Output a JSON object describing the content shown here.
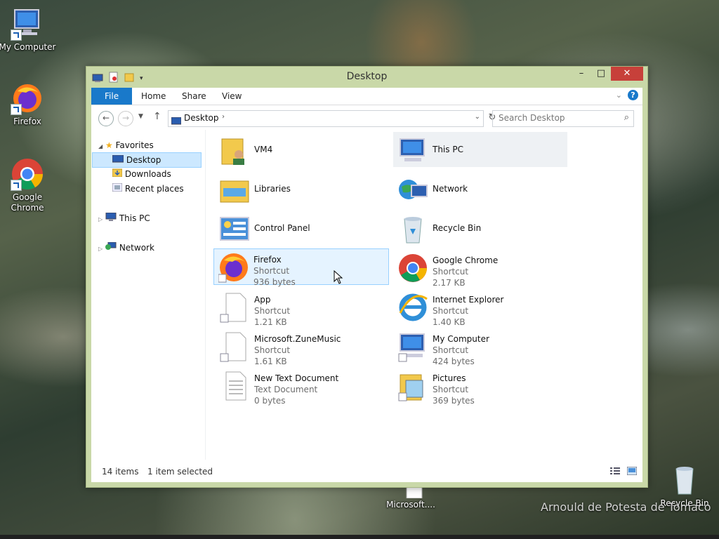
{
  "desktop": {
    "icons": [
      {
        "label": "My Computer"
      },
      {
        "label": "Firefox"
      },
      {
        "label": "Google Chrome"
      },
      {
        "label": "Recycle Bin"
      },
      {
        "label": "Microsoft...."
      }
    ],
    "watermark": "Arnould de Potesta de Tomaco"
  },
  "window": {
    "title": "Desktop",
    "ribbon_tabs": [
      "File",
      "Home",
      "Share",
      "View"
    ],
    "address": {
      "location": "Desktop"
    },
    "search": {
      "placeholder": "Search Desktop"
    },
    "nav": {
      "favorites": "Favorites",
      "desktop": "Desktop",
      "downloads": "Downloads",
      "recent": "Recent places",
      "this_pc": "This PC",
      "network": "Network"
    },
    "items": [
      {
        "name": "VM4"
      },
      {
        "name": "This PC"
      },
      {
        "name": "Libraries"
      },
      {
        "name": "Network"
      },
      {
        "name": "Control Panel"
      },
      {
        "name": "Recycle Bin"
      },
      {
        "name": "Firefox",
        "type": "Shortcut",
        "size": "936 bytes"
      },
      {
        "name": "Google Chrome",
        "type": "Shortcut",
        "size": "2.17 KB"
      },
      {
        "name": "App",
        "type": "Shortcut",
        "size": "1.21 KB"
      },
      {
        "name": "Internet Explorer",
        "type": "Shortcut",
        "size": "1.40 KB"
      },
      {
        "name": "Microsoft.ZuneMusic",
        "type": "Shortcut",
        "size": "1.61 KB"
      },
      {
        "name": "My Computer",
        "type": "Shortcut",
        "size": "424 bytes"
      },
      {
        "name": "New Text Document",
        "type": "Text Document",
        "size": "0 bytes"
      },
      {
        "name": "Pictures",
        "type": "Shortcut",
        "size": "369 bytes"
      }
    ],
    "status": {
      "count": "14 items",
      "selection": "1 item selected"
    }
  }
}
